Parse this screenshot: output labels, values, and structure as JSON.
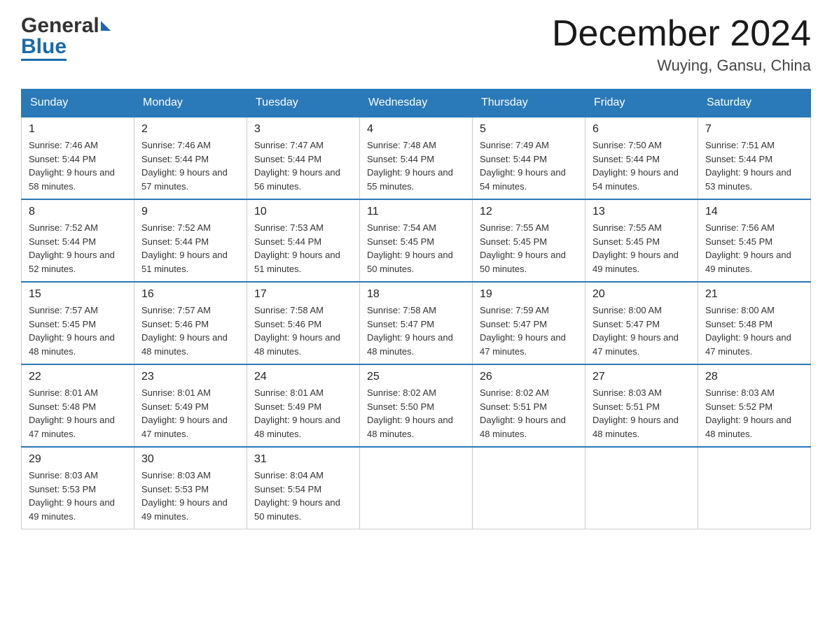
{
  "logo": {
    "general": "General",
    "blue": "Blue"
  },
  "title": "December 2024",
  "subtitle": "Wuying, Gansu, China",
  "days_of_week": [
    "Sunday",
    "Monday",
    "Tuesday",
    "Wednesday",
    "Thursday",
    "Friday",
    "Saturday"
  ],
  "weeks": [
    [
      {
        "day": "1",
        "sunrise": "7:46 AM",
        "sunset": "5:44 PM",
        "daylight": "9 hours and 58 minutes."
      },
      {
        "day": "2",
        "sunrise": "7:46 AM",
        "sunset": "5:44 PM",
        "daylight": "9 hours and 57 minutes."
      },
      {
        "day": "3",
        "sunrise": "7:47 AM",
        "sunset": "5:44 PM",
        "daylight": "9 hours and 56 minutes."
      },
      {
        "day": "4",
        "sunrise": "7:48 AM",
        "sunset": "5:44 PM",
        "daylight": "9 hours and 55 minutes."
      },
      {
        "day": "5",
        "sunrise": "7:49 AM",
        "sunset": "5:44 PM",
        "daylight": "9 hours and 54 minutes."
      },
      {
        "day": "6",
        "sunrise": "7:50 AM",
        "sunset": "5:44 PM",
        "daylight": "9 hours and 54 minutes."
      },
      {
        "day": "7",
        "sunrise": "7:51 AM",
        "sunset": "5:44 PM",
        "daylight": "9 hours and 53 minutes."
      }
    ],
    [
      {
        "day": "8",
        "sunrise": "7:52 AM",
        "sunset": "5:44 PM",
        "daylight": "9 hours and 52 minutes."
      },
      {
        "day": "9",
        "sunrise": "7:52 AM",
        "sunset": "5:44 PM",
        "daylight": "9 hours and 51 minutes."
      },
      {
        "day": "10",
        "sunrise": "7:53 AM",
        "sunset": "5:44 PM",
        "daylight": "9 hours and 51 minutes."
      },
      {
        "day": "11",
        "sunrise": "7:54 AM",
        "sunset": "5:45 PM",
        "daylight": "9 hours and 50 minutes."
      },
      {
        "day": "12",
        "sunrise": "7:55 AM",
        "sunset": "5:45 PM",
        "daylight": "9 hours and 50 minutes."
      },
      {
        "day": "13",
        "sunrise": "7:55 AM",
        "sunset": "5:45 PM",
        "daylight": "9 hours and 49 minutes."
      },
      {
        "day": "14",
        "sunrise": "7:56 AM",
        "sunset": "5:45 PM",
        "daylight": "9 hours and 49 minutes."
      }
    ],
    [
      {
        "day": "15",
        "sunrise": "7:57 AM",
        "sunset": "5:45 PM",
        "daylight": "9 hours and 48 minutes."
      },
      {
        "day": "16",
        "sunrise": "7:57 AM",
        "sunset": "5:46 PM",
        "daylight": "9 hours and 48 minutes."
      },
      {
        "day": "17",
        "sunrise": "7:58 AM",
        "sunset": "5:46 PM",
        "daylight": "9 hours and 48 minutes."
      },
      {
        "day": "18",
        "sunrise": "7:58 AM",
        "sunset": "5:47 PM",
        "daylight": "9 hours and 48 minutes."
      },
      {
        "day": "19",
        "sunrise": "7:59 AM",
        "sunset": "5:47 PM",
        "daylight": "9 hours and 47 minutes."
      },
      {
        "day": "20",
        "sunrise": "8:00 AM",
        "sunset": "5:47 PM",
        "daylight": "9 hours and 47 minutes."
      },
      {
        "day": "21",
        "sunrise": "8:00 AM",
        "sunset": "5:48 PM",
        "daylight": "9 hours and 47 minutes."
      }
    ],
    [
      {
        "day": "22",
        "sunrise": "8:01 AM",
        "sunset": "5:48 PM",
        "daylight": "9 hours and 47 minutes."
      },
      {
        "day": "23",
        "sunrise": "8:01 AM",
        "sunset": "5:49 PM",
        "daylight": "9 hours and 47 minutes."
      },
      {
        "day": "24",
        "sunrise": "8:01 AM",
        "sunset": "5:49 PM",
        "daylight": "9 hours and 48 minutes."
      },
      {
        "day": "25",
        "sunrise": "8:02 AM",
        "sunset": "5:50 PM",
        "daylight": "9 hours and 48 minutes."
      },
      {
        "day": "26",
        "sunrise": "8:02 AM",
        "sunset": "5:51 PM",
        "daylight": "9 hours and 48 minutes."
      },
      {
        "day": "27",
        "sunrise": "8:03 AM",
        "sunset": "5:51 PM",
        "daylight": "9 hours and 48 minutes."
      },
      {
        "day": "28",
        "sunrise": "8:03 AM",
        "sunset": "5:52 PM",
        "daylight": "9 hours and 48 minutes."
      }
    ],
    [
      {
        "day": "29",
        "sunrise": "8:03 AM",
        "sunset": "5:53 PM",
        "daylight": "9 hours and 49 minutes."
      },
      {
        "day": "30",
        "sunrise": "8:03 AM",
        "sunset": "5:53 PM",
        "daylight": "9 hours and 49 minutes."
      },
      {
        "day": "31",
        "sunrise": "8:04 AM",
        "sunset": "5:54 PM",
        "daylight": "9 hours and 50 minutes."
      },
      null,
      null,
      null,
      null
    ]
  ]
}
